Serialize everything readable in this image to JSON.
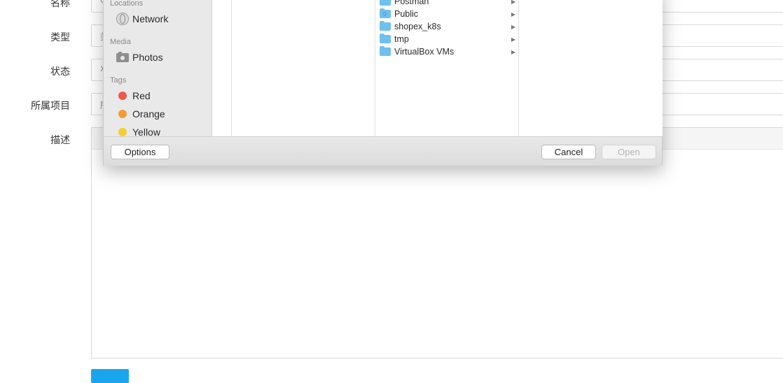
{
  "form": {
    "fields": [
      {
        "label": "名称",
        "peek": "c"
      },
      {
        "label": "类型",
        "peek": "类"
      },
      {
        "label": "状态",
        "peek": "x"
      },
      {
        "label": "所属项目",
        "peek": "所"
      },
      {
        "label": "描述"
      }
    ]
  },
  "dialog": {
    "sidebar": {
      "locations_header": "Locations",
      "network_label": "Network",
      "media_header": "Media",
      "photos_label": "Photos",
      "tags_header": "Tags",
      "tags": [
        {
          "label": "Red",
          "color": "#f0574e"
        },
        {
          "label": "Orange",
          "color": "#f59b35"
        },
        {
          "label": "Yellow",
          "color": "#f5cf2b"
        }
      ]
    },
    "files": [
      {
        "name": "Postman",
        "icon": "folder-icon"
      },
      {
        "name": "Public",
        "icon": "public-folder-icon"
      },
      {
        "name": "shopex_k8s",
        "icon": "folder-icon"
      },
      {
        "name": "tmp",
        "icon": "folder-icon"
      },
      {
        "name": "VirtualBox VMs",
        "icon": "folder-icon"
      }
    ],
    "buttons": {
      "options": "Options",
      "cancel": "Cancel",
      "open": "Open"
    }
  }
}
